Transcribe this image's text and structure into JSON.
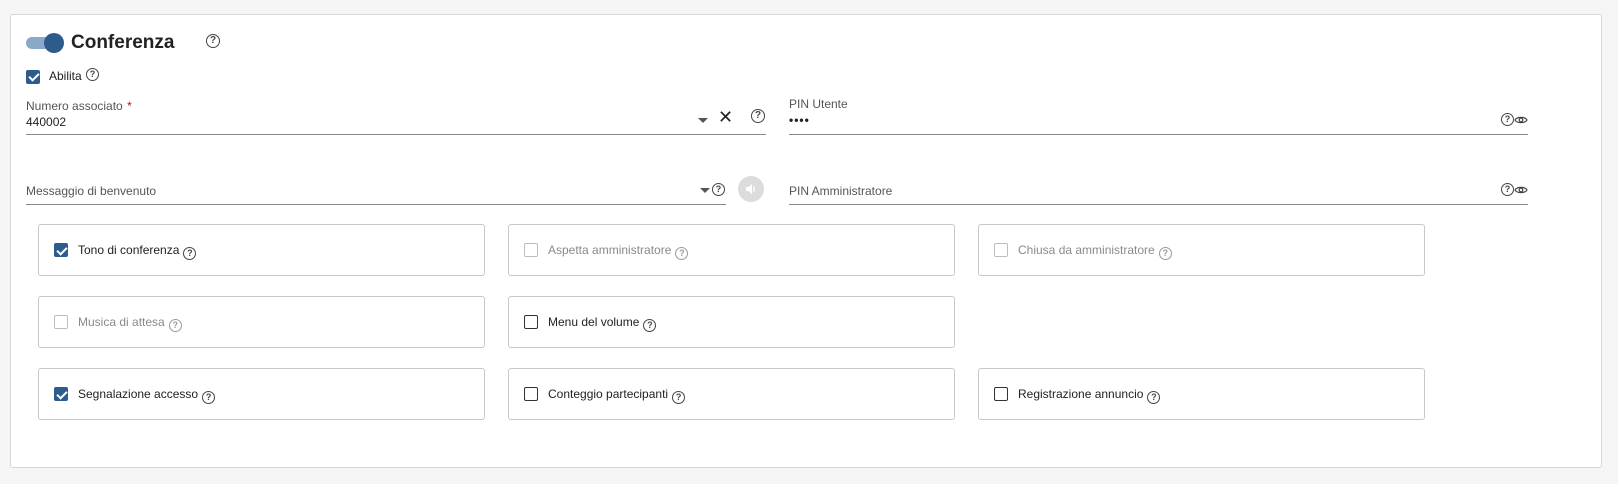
{
  "section": {
    "title": "Conferenza",
    "toggle_on": true,
    "enable_label": "Abilita",
    "enable_checked": true
  },
  "fields": {
    "numero": {
      "label": "Numero associato",
      "required_mark": "*",
      "value": "440002"
    },
    "pin_utente": {
      "label": "PIN Utente",
      "value": "••••"
    },
    "messaggio": {
      "label": "Messaggio di benvenuto",
      "value": ""
    },
    "pin_admin": {
      "label": "PIN Amministratore",
      "value": ""
    }
  },
  "icons": {
    "help": "?",
    "clear": "✕"
  },
  "options": [
    {
      "label": "Tono di conferenza",
      "checked": true,
      "disabled": false
    },
    {
      "label": "Aspetta amministratore",
      "checked": false,
      "disabled": true
    },
    {
      "label": "Chiusa da amministratore",
      "checked": false,
      "disabled": true
    },
    {
      "label": "Musica di attesa",
      "checked": false,
      "disabled": true
    },
    {
      "label": "Menu del volume",
      "checked": false,
      "disabled": false
    },
    {
      "label": "Segnalazione accesso",
      "checked": true,
      "disabled": false
    },
    {
      "label": "Conteggio partecipanti",
      "checked": false,
      "disabled": false
    },
    {
      "label": "Registrazione annuncio",
      "checked": false,
      "disabled": false
    }
  ],
  "colors": {
    "accent": "#2d5b8c",
    "toggle_track": "#8aa8c8"
  }
}
